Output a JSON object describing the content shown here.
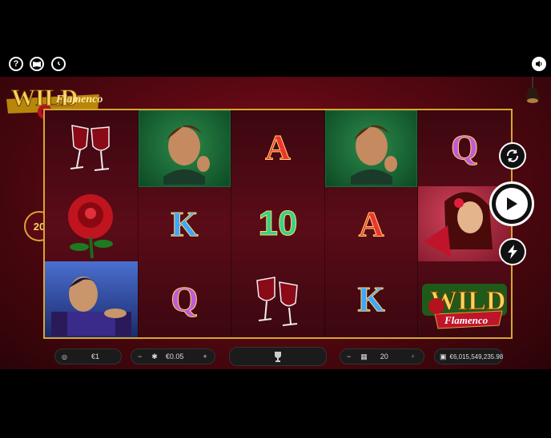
{
  "top_icons": [
    "help-icon",
    "paytable-book-icon",
    "history-icon"
  ],
  "sound_icon": "speaker-icon",
  "logo": {
    "word1": "WILD",
    "word2": "Flamenco"
  },
  "lines_count": "20",
  "reels": [
    [
      {
        "sym": "wine",
        "label": ""
      },
      {
        "sym": "rose",
        "label": ""
      },
      {
        "sym": "man-blue",
        "label": ""
      }
    ],
    [
      {
        "sym": "man-green",
        "label": ""
      },
      {
        "sym": "card",
        "label": "K"
      },
      {
        "sym": "card",
        "label": "Q"
      }
    ],
    [
      {
        "sym": "card",
        "label": "A"
      },
      {
        "sym": "card",
        "label": "10"
      },
      {
        "sym": "wine",
        "label": ""
      }
    ],
    [
      {
        "sym": "man-green",
        "label": ""
      },
      {
        "sym": "card",
        "label": "A"
      },
      {
        "sym": "card",
        "label": "K"
      }
    ],
    [
      {
        "sym": "card",
        "label": "Q"
      },
      {
        "sym": "woman",
        "label": ""
      },
      {
        "sym": "wild",
        "label": "WILD"
      }
    ]
  ],
  "wild_symbol": {
    "word1": "WILD",
    "word2": "Flamenco"
  },
  "bottom": {
    "bet_value": "€1",
    "coin_value": "€0.05",
    "minus": "−",
    "plus": "+",
    "lines": "20",
    "balance": "€6,015,549,235.98"
  },
  "colors": {
    "gold": "#d6a632",
    "accent_red": "#8a1020"
  }
}
